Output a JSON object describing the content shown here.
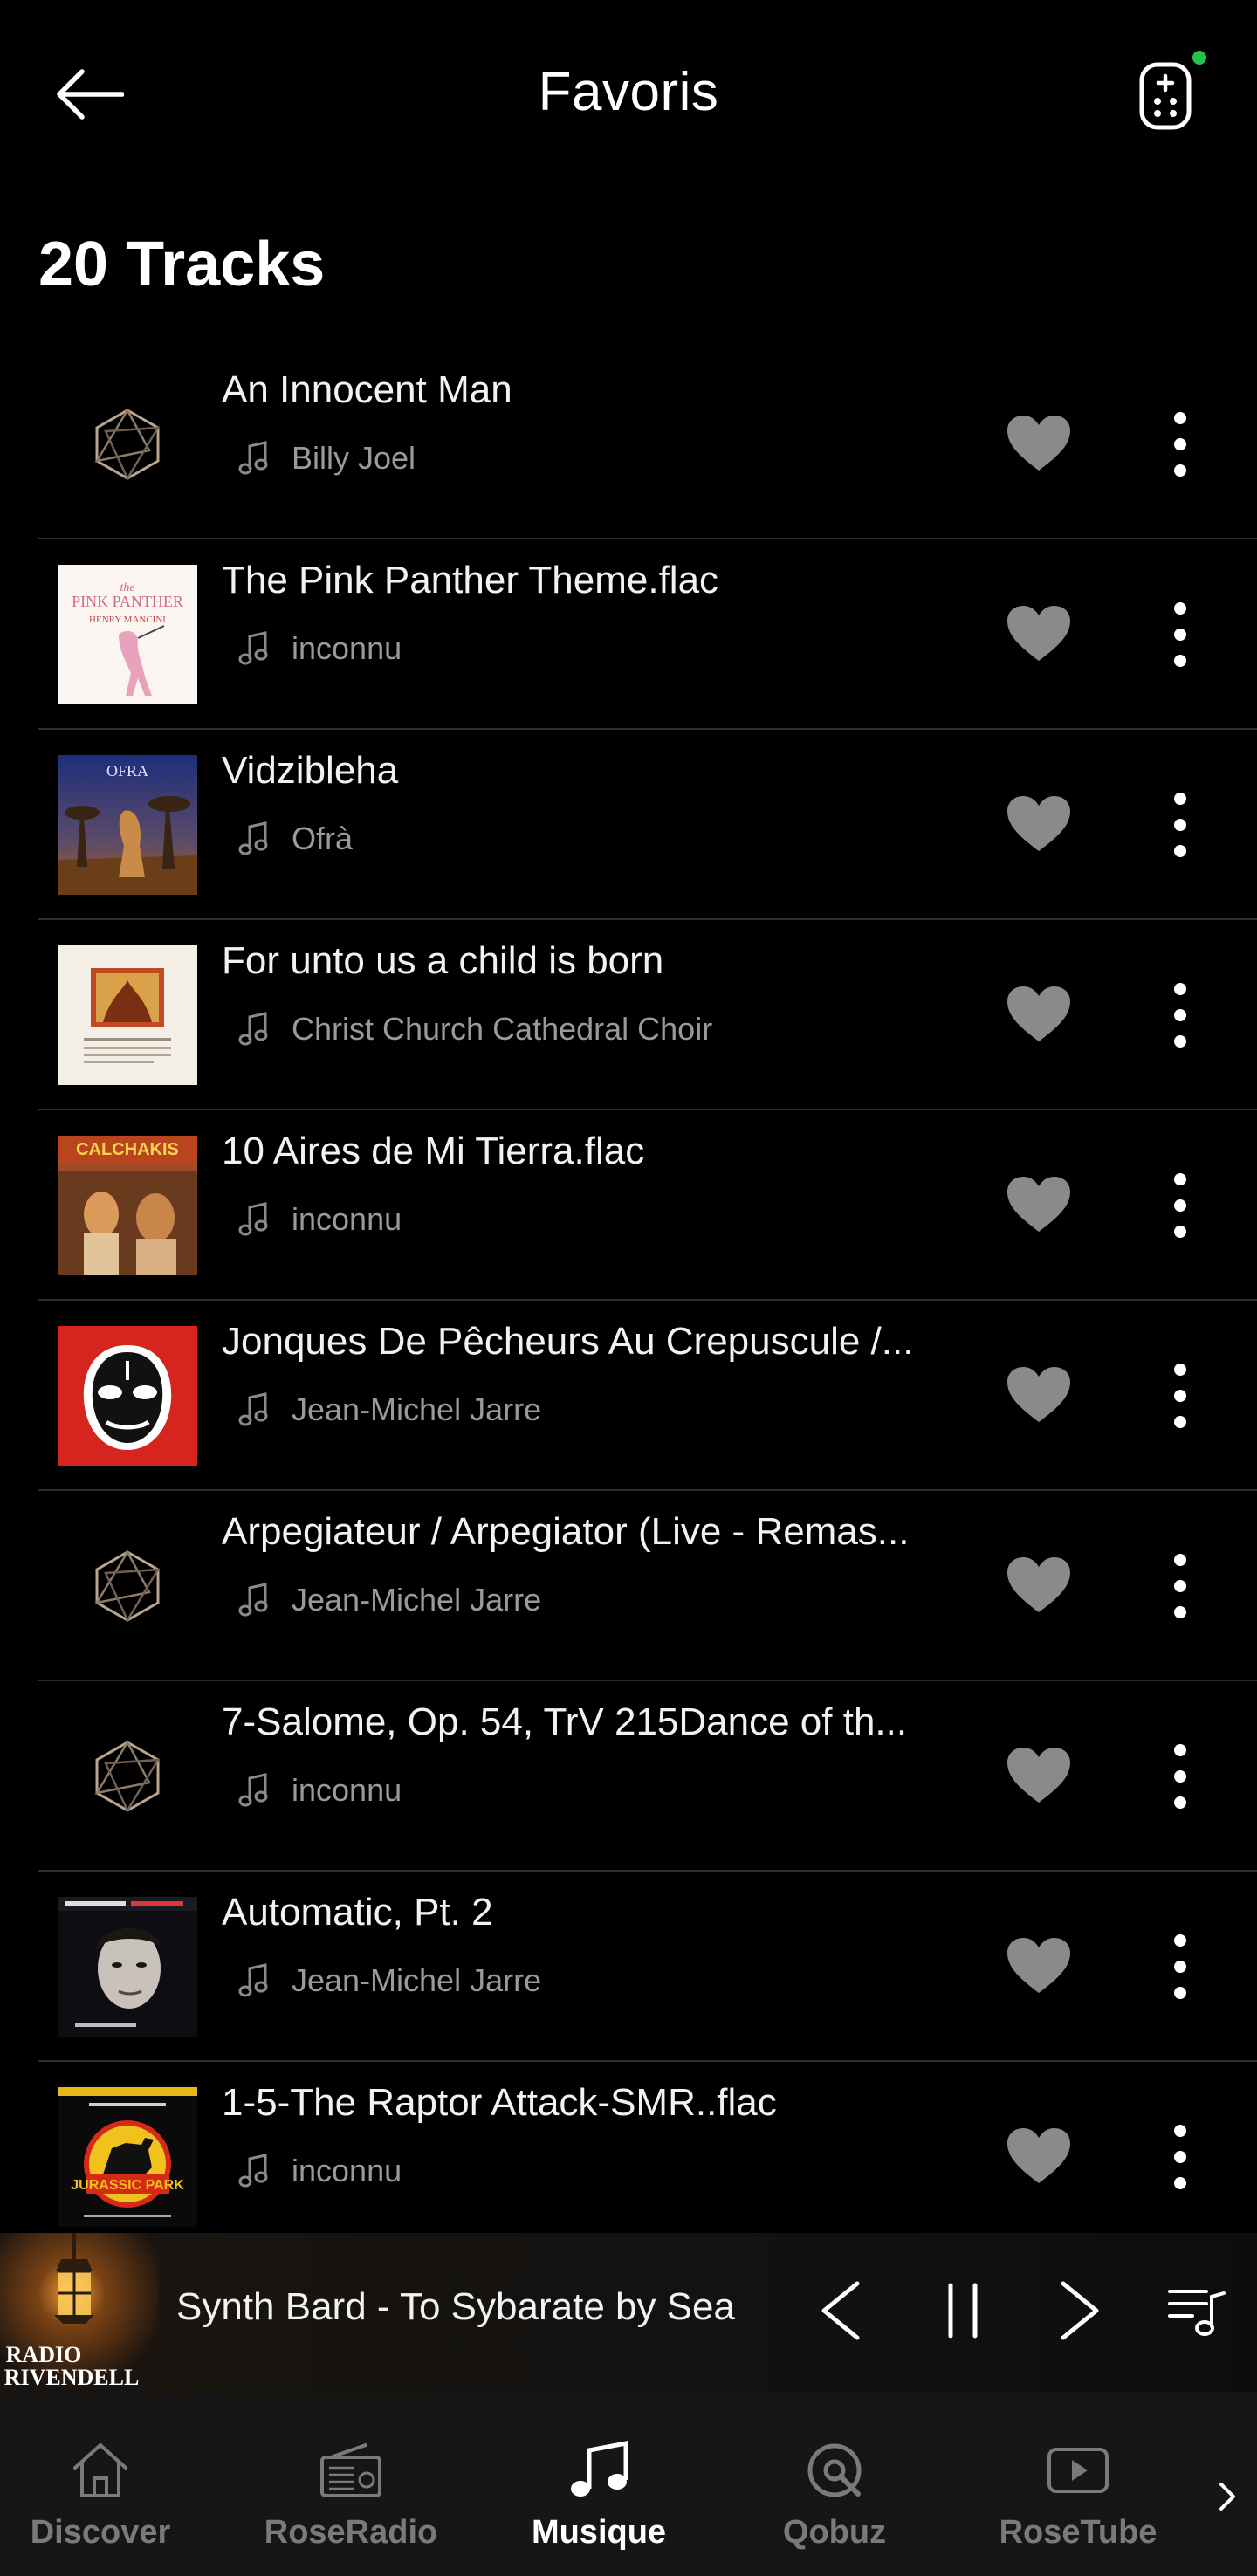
{
  "header": {
    "title": "Favoris",
    "back_icon": "arrow-left-icon",
    "remote_icon": "remote-control-icon",
    "status_color": "#26c24b"
  },
  "list": {
    "count_label": "20 Tracks",
    "tracks": [
      {
        "title": "An Innocent Man",
        "artist": "Billy Joel",
        "art": "placeholder"
      },
      {
        "title": "The Pink Panther Theme.flac",
        "artist": "inconnu",
        "art": "pink-panther"
      },
      {
        "title": "Vidzibleha",
        "artist": "Ofrà",
        "art": "ofra"
      },
      {
        "title": "For unto us a child is born",
        "artist": "Christ Church Cathedral Choir",
        "art": "handel"
      },
      {
        "title": "10 Aires de Mi Tierra.flac",
        "artist": "inconnu",
        "art": "calchakis"
      },
      {
        "title": "Jonques De Pêcheurs Au Crepuscule /...",
        "artist": "Jean-Michel Jarre",
        "art": "jarre-china"
      },
      {
        "title": "Arpegiateur / Arpegiator (Live - Remas...",
        "artist": "Jean-Michel Jarre",
        "art": "placeholder"
      },
      {
        "title": "7-Salome, Op. 54, TrV 215Dance of th...",
        "artist": "inconnu",
        "art": "placeholder"
      },
      {
        "title": "Automatic, Pt. 2",
        "artist": "Jean-Michel Jarre",
        "art": "electronica"
      },
      {
        "title": "1-5-The Raptor Attack-SMR..flac",
        "artist": "inconnu",
        "art": "jurassic"
      }
    ]
  },
  "player": {
    "now_playing": "Synth Bard - To Sybarate by Sea",
    "station_art_text_1": "RADIO",
    "station_art_text_2": "RIVENDELL"
  },
  "nav": {
    "items": [
      {
        "label": "Discover",
        "icon": "home-icon",
        "active": false
      },
      {
        "label": "RoseRadio",
        "icon": "radio-icon",
        "active": false
      },
      {
        "label": "Musique",
        "icon": "music-note-icon",
        "active": true
      },
      {
        "label": "Qobuz",
        "icon": "qobuz-icon",
        "active": false
      },
      {
        "label": "RoseTube",
        "icon": "play-video-icon",
        "active": false
      }
    ]
  },
  "colors": {
    "background": "#000000",
    "heart": "#8a8a8a",
    "secondary_text": "#9a9a9a",
    "divider": "#2c2c2c",
    "nav_background": "#161616"
  }
}
